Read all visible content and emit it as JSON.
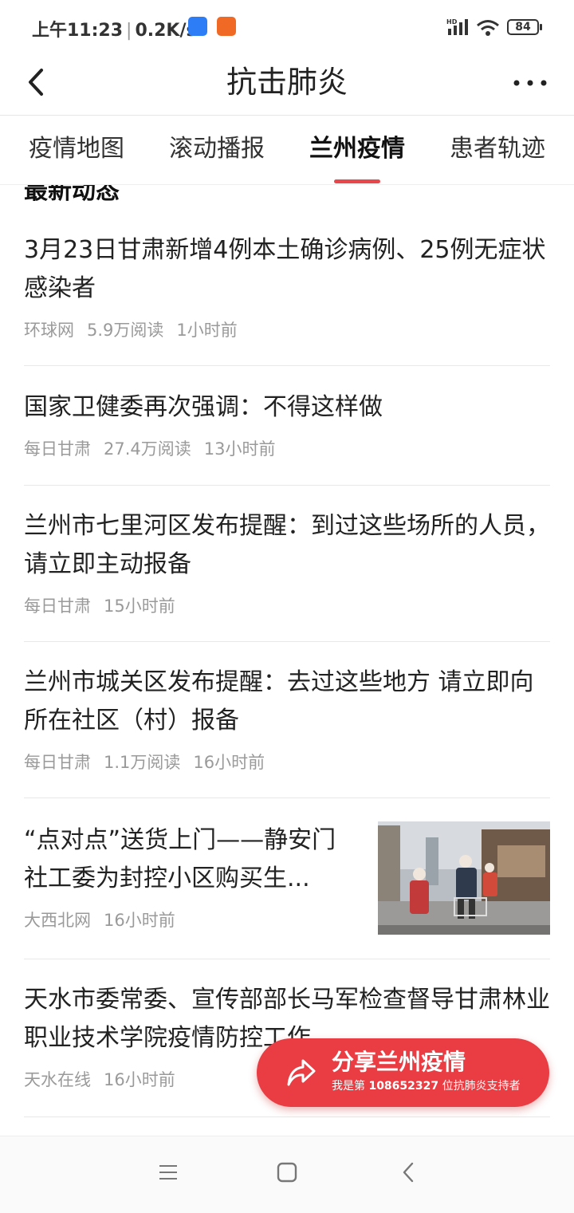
{
  "status_bar": {
    "time": "上午11:23",
    "net_speed": "0.2K/s",
    "signal_label": "HD",
    "battery": "84"
  },
  "header": {
    "title": "抗击肺炎"
  },
  "tabs": [
    {
      "label": "疫情地图"
    },
    {
      "label": "滚动播报"
    },
    {
      "label": "兰州疫情",
      "active": true
    },
    {
      "label": "患者轨迹"
    }
  ],
  "section": {
    "title": "最新动态"
  },
  "news": [
    {
      "headline": "3月23日甘肃新增4例本土确诊病例、25例无症状感染者",
      "source": "环球网",
      "reads": "5.9万阅读",
      "time": "1小时前"
    },
    {
      "headline": "国家卫健委再次强调：不得这样做",
      "source": "每日甘肃",
      "reads": "27.4万阅读",
      "time": "13小时前"
    },
    {
      "headline": "兰州市七里河区发布提醒：到过这些场所的人员，请立即主动报备",
      "source": "每日甘肃",
      "reads": "",
      "time": "15小时前"
    },
    {
      "headline": "兰州市城关区发布提醒：去过这些地方 请立即向所在社区（村）报备",
      "source": "每日甘肃",
      "reads": "1.1万阅读",
      "time": "16小时前"
    },
    {
      "headline": "“点对点”送货上门——静安门社工委为封控小区购买生...",
      "source": "大西北网",
      "reads": "",
      "time": "16小时前"
    },
    {
      "headline": "天水市委常委、宣传部部长马军检查督导甘肃林业职业技术学院疫情防控工作",
      "source": "天水在线",
      "reads": "",
      "time": "16小时前"
    }
  ],
  "share": {
    "title": "分享兰州疫情",
    "sub_prefix": "我是第",
    "count": "108652327",
    "sub_suffix": "位抗肺炎支持者"
  },
  "colors": {
    "accent": "#e8484c",
    "share_bg": "#e93d43"
  }
}
